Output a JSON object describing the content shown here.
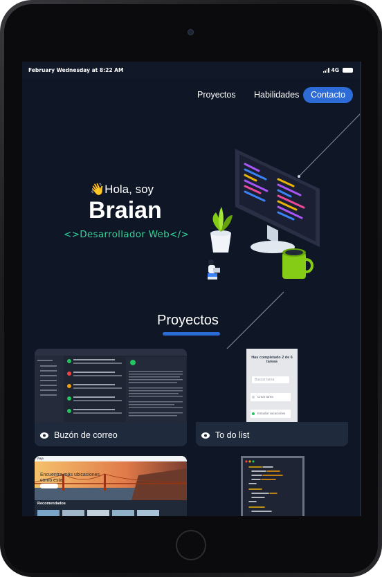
{
  "status_bar": {
    "time": "February Wednesday at 8:22 AM",
    "network": "4G"
  },
  "nav": {
    "items": [
      "Proyectos",
      "Habilidades"
    ],
    "cta": "Contacto"
  },
  "hero": {
    "greeting_emoji": "👋",
    "greeting": "Hola, soy",
    "name": "Braian",
    "role": "<>Desarrollador Web</>"
  },
  "projects": {
    "title": "Proyectos",
    "cards": [
      {
        "label": "Buzón de correo"
      },
      {
        "label": "To do list"
      }
    ],
    "todo_preview": {
      "heading": "Has completado 2 de 6 tareas",
      "search_placeholder": "Buscar tarea",
      "items": [
        "Crear tarea",
        "Estudiar vacaciones"
      ]
    },
    "travel_preview": {
      "brand": "Viaja",
      "hero_text": "Encuentra más ubicaciones como esta",
      "section": "Recomendados"
    }
  },
  "colors": {
    "accent": "#2d6bd6",
    "role_green": "#34d399",
    "screen_bg": "#0f1626"
  }
}
